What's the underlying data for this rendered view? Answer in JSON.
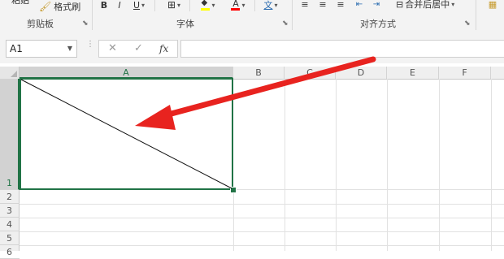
{
  "ribbon": {
    "clipboard": {
      "group_label": "剪贴板",
      "paste_label": "粘贴",
      "format_painter_label": "格式刷"
    },
    "font": {
      "group_label": "字体",
      "bold": "B",
      "italic": "I",
      "underline": "U",
      "borders_icon": "borders-icon",
      "fill_icon": "fill-color-icon",
      "font_color_letter": "A",
      "phonetic_label": "文"
    },
    "alignment": {
      "group_label": "对齐方式",
      "merge_center_label": "合并后居中"
    },
    "colors": {
      "fill_swatch": "#ffff00",
      "font_swatch": "#ff0000"
    }
  },
  "formula_bar": {
    "name_box": "A1",
    "cancel_symbol": "✕",
    "enter_symbol": "✓",
    "fx_symbol": "fx",
    "formula_value": ""
  },
  "grid": {
    "columns": [
      "A",
      "B",
      "C",
      "D",
      "E",
      "F"
    ],
    "rows": [
      "1",
      "2",
      "3",
      "4",
      "5",
      "6"
    ],
    "selected_cell": "A1"
  },
  "annotation": {
    "arrow_color": "#e8231f",
    "accent": "#217346"
  }
}
